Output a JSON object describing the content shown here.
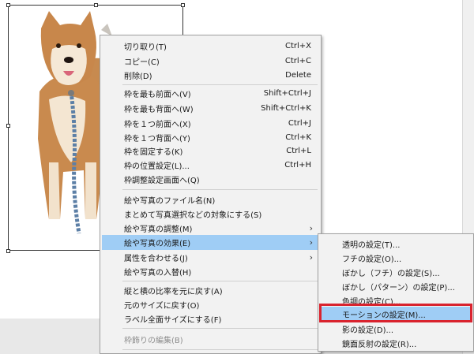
{
  "menu": {
    "items": [
      {
        "label": "切り取り(T)",
        "shortcut": "Ctrl+X"
      },
      {
        "label": "コピー(C)",
        "shortcut": "Ctrl+C"
      },
      {
        "label": "削除(D)",
        "shortcut": "Delete"
      },
      {
        "label": "枠を最も前面へ(V)",
        "shortcut": "Shift+Ctrl+J"
      },
      {
        "label": "枠を最も背面へ(W)",
        "shortcut": "Shift+Ctrl+K"
      },
      {
        "label": "枠を１つ前面へ(X)",
        "shortcut": "Ctrl+J"
      },
      {
        "label": "枠を１つ背面へ(Y)",
        "shortcut": "Ctrl+K"
      },
      {
        "label": "枠を固定する(K)",
        "shortcut": "Ctrl+L"
      },
      {
        "label": "枠の位置設定(L)...",
        "shortcut": "Ctrl+H"
      },
      {
        "label": "枠調整設定画面へ(Q)",
        "shortcut": ""
      },
      {
        "label": "絵や写真のファイル名(N)",
        "shortcut": ""
      },
      {
        "label": "まとめて写真選択などの対象にする(S)",
        "shortcut": ""
      },
      {
        "label": "絵や写真の調整(M)",
        "shortcut": ""
      },
      {
        "label": "絵や写真の効果(E)",
        "shortcut": ""
      },
      {
        "label": "属性を合わせる(J)",
        "shortcut": ""
      },
      {
        "label": "絵や写真の入替(H)",
        "shortcut": ""
      },
      {
        "label": "縦と横の比率を元に戻す(A)",
        "shortcut": ""
      },
      {
        "label": "元のサイズに戻す(O)",
        "shortcut": ""
      },
      {
        "label": "ラベル全面サイズにする(F)",
        "shortcut": ""
      },
      {
        "label": "枠飾りの編集(B)",
        "shortcut": ""
      }
    ],
    "arrow": "›"
  },
  "submenu": {
    "items": [
      "透明の設定(T)...",
      "フチの設定(O)...",
      "ぼかし（フチ）の設定(S)...",
      "ぼかし（パターン）の設定(P)...",
      "色調の設定(C)...",
      "モーションの設定(M)...",
      "影の設定(D)...",
      "鏡面反射の設定(R)..."
    ]
  },
  "colors": {
    "highlight": "#9fcdf5",
    "callout": "#d9232e",
    "menu_bg": "#f2f2f2"
  }
}
